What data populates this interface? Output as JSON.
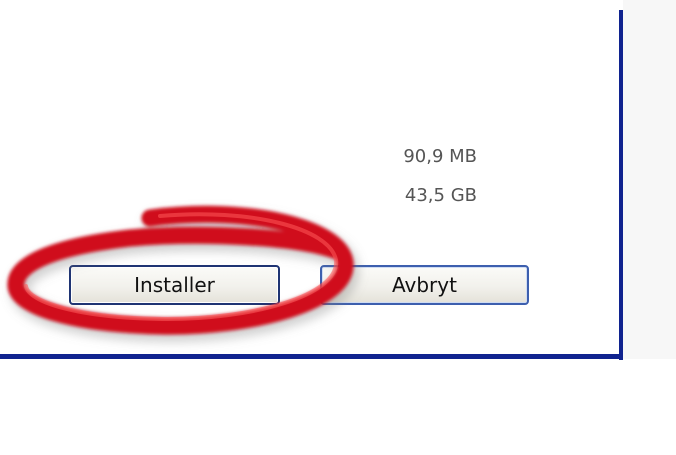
{
  "sizes": {
    "download_size": "90,9 MB",
    "free_space": "43,5 GB"
  },
  "buttons": {
    "install_label": "Installer",
    "cancel_label": "Avbryt"
  },
  "colors": {
    "frame_blue": "#10238f",
    "annotation_red": "#d0101a"
  }
}
